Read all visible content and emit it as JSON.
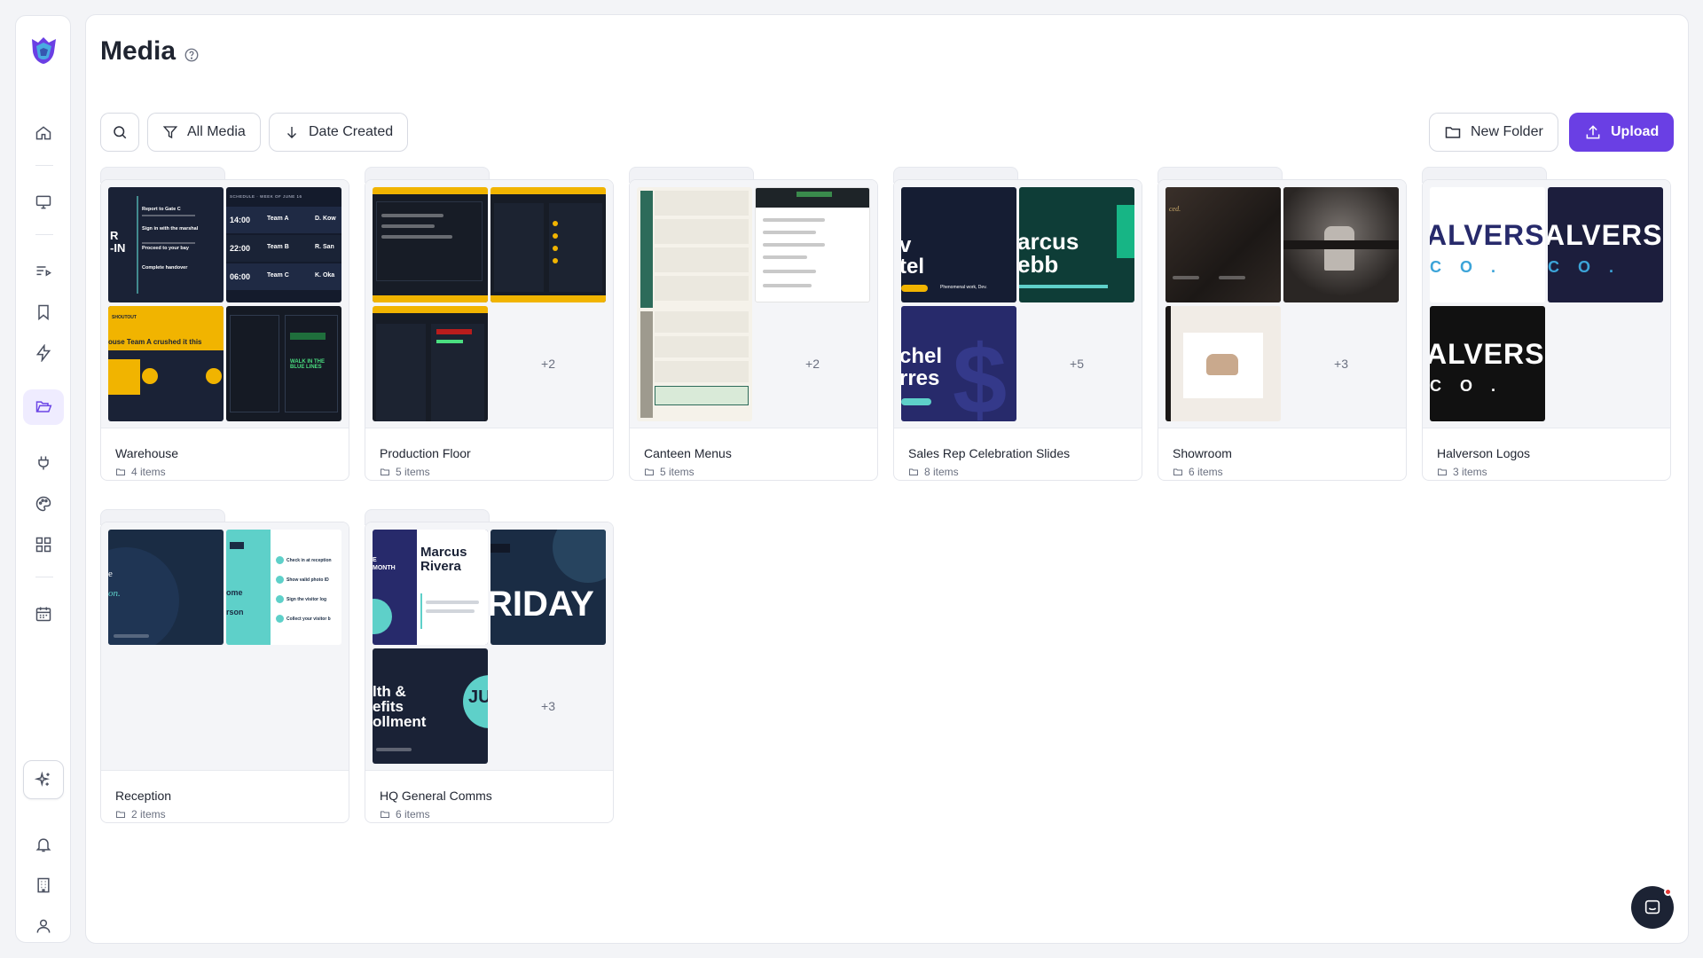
{
  "page": {
    "title": "Media"
  },
  "toolbar": {
    "filter_label": "All Media",
    "sort_label": "Date Created",
    "new_folder_label": "New Folder",
    "upload_label": "Upload"
  },
  "sidebar": {
    "items": [
      {
        "name": "home-icon"
      },
      {
        "name": "monitor-icon"
      },
      {
        "name": "playlist-icon"
      },
      {
        "name": "bookmark-icon"
      },
      {
        "name": "lightning-icon"
      },
      {
        "name": "folder-open-icon",
        "active": true
      },
      {
        "name": "plug-icon"
      },
      {
        "name": "palette-icon"
      },
      {
        "name": "apps-grid-icon"
      },
      {
        "name": "calendar-icon"
      },
      {
        "name": "sparkles-icon"
      },
      {
        "name": "bell-icon"
      },
      {
        "name": "building-icon"
      },
      {
        "name": "user-icon"
      }
    ]
  },
  "folders": [
    {
      "name": "Warehouse",
      "count": "4 items",
      "more": ""
    },
    {
      "name": "Production Floor",
      "count": "5 items",
      "more": "+2"
    },
    {
      "name": "Canteen Menus",
      "count": "5 items",
      "more": "+2"
    },
    {
      "name": "Sales Rep Celebration Slides",
      "count": "8 items",
      "more": "+5"
    },
    {
      "name": "Showroom",
      "count": "6 items",
      "more": "+3"
    },
    {
      "name": "Halverson Logos",
      "count": "3 items",
      "more": ""
    },
    {
      "name": "Reception",
      "count": "2 items",
      "more": ""
    },
    {
      "name": "HQ General Comms",
      "count": "6 items",
      "more": "+3"
    }
  ],
  "thumb_text": {
    "warehouse": {
      "t1_big": "R\n-IN",
      "t2_header": "SCHEDULE · WEEK OF JUNE 16",
      "t2_rows": [
        "14:00",
        "22:00",
        "06:00"
      ],
      "t2_teams": [
        "Team A",
        "Team B",
        "Team C"
      ],
      "t2_names": [
        "D. Kow",
        "R. San",
        "K. Oka"
      ],
      "t1_steps": [
        "Report to Gate C",
        "Sign in with the marshal",
        "Proceed to your bay",
        "Complete handover"
      ],
      "t3_header": "SHOUTOUT",
      "t3_text": "ouse Team A crushed it this",
      "t4_text": "WALK IN THE BLUE LINES"
    },
    "sales": {
      "t1_big": "v\ntel",
      "t2_big": "arcus\nebb",
      "t3_big": "chel\nrres",
      "t1_foot": "Phenomenal work, Dev."
    },
    "logos": {
      "word": "ALVERS",
      "sub": "C O ."
    },
    "reception": {
      "t2_a": "ome",
      "t2_b": "rson",
      "t2_steps": [
        "Check in at reception",
        "Show valid photo ID",
        "Sign the visitor log",
        "Collect your visitor b"
      ]
    },
    "hq": {
      "t1_name": "Marcus\nRivera",
      "t1_month": "E\nMONTH",
      "t2_big": "RIDAY",
      "t3_big": "lth &\nefits\nollment",
      "t3_circle": "JU"
    }
  }
}
